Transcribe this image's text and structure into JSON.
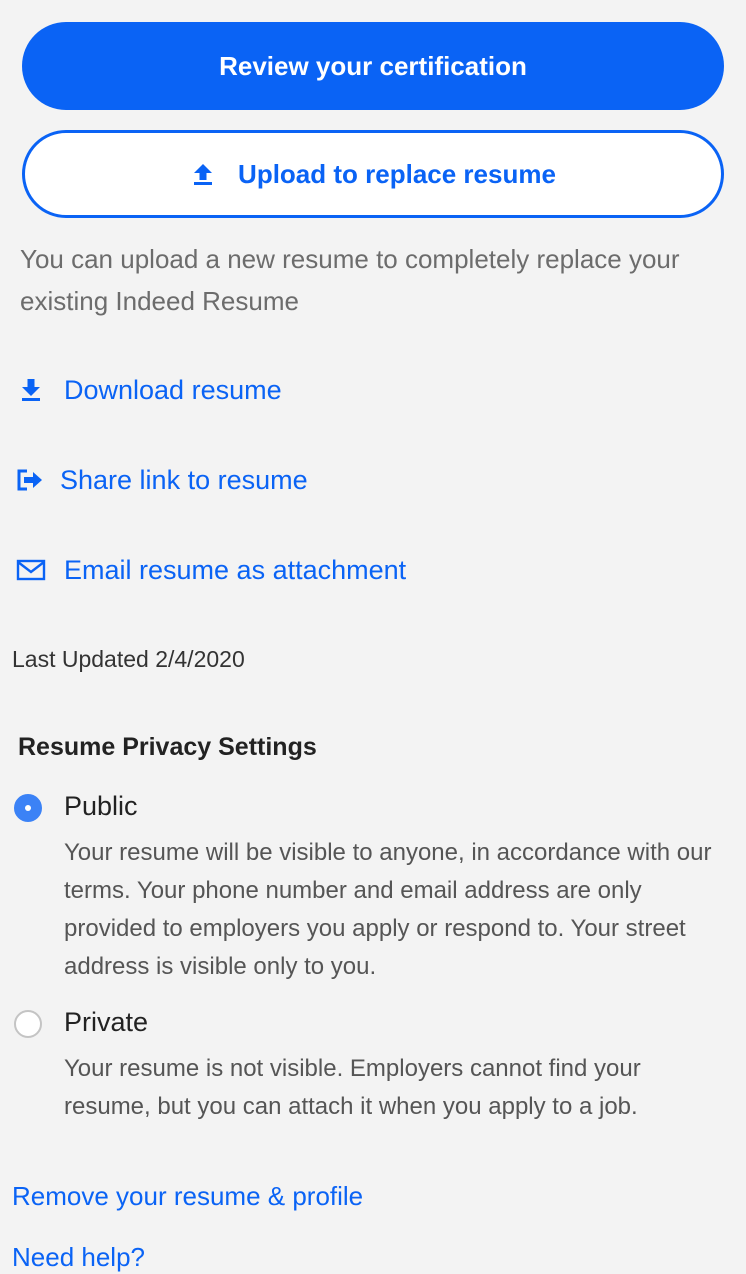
{
  "actions": {
    "review_label": "Review your certification",
    "upload_label": "Upload to replace resume",
    "upload_description": "You can upload a new resume to completely replace your existing Indeed Resume",
    "download_label": "Download resume",
    "share_label": "Share link to resume",
    "email_label": "Email resume as attachment"
  },
  "last_updated": "Last Updated 2/4/2020",
  "privacy": {
    "heading": "Resume Privacy Settings",
    "options": [
      {
        "label": "Public",
        "description": "Your resume will be visible to anyone, in accordance with our terms. Your phone number and email address are only provided to employers you apply or respond to. Your street address is visible only to you.",
        "selected": true
      },
      {
        "label": "Private",
        "description": "Your resume is not visible. Employers cannot find your resume, but you can attach it when you apply to a job.",
        "selected": false
      }
    ]
  },
  "footer": {
    "remove_label": "Remove your resume & profile",
    "help_label": "Need help?"
  },
  "colors": {
    "accent": "#0a63f5",
    "background": "#f3f3f3",
    "radio_selected": "#3b82f6"
  },
  "icons": {
    "upload": "upload-icon",
    "download": "download-icon",
    "share": "share-icon",
    "email": "email-icon"
  }
}
